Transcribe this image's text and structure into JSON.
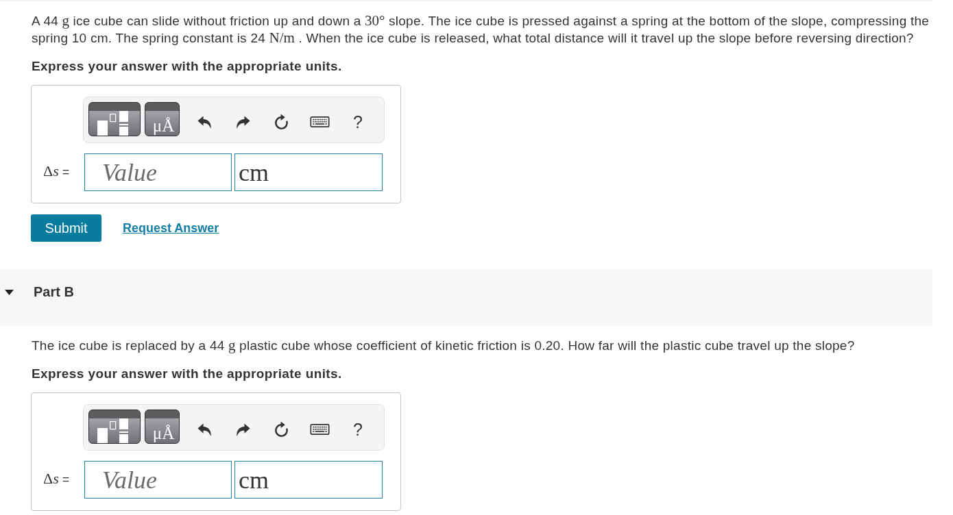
{
  "parts": [
    {
      "question": [
        {
          "kind": "text",
          "text": "A 44 "
        },
        {
          "kind": "math",
          "text": "g"
        },
        {
          "kind": "text",
          "text": " ice cube can slide without friction up and down a "
        },
        {
          "kind": "math",
          "text": "30°"
        },
        {
          "kind": "text",
          "text": " slope. The ice cube is pressed against a spring at the bottom of the slope, compressing the spring 10 cm. The spring constant is 24 "
        },
        {
          "kind": "math",
          "text": "N/m"
        },
        {
          "kind": "text",
          "text": " . When the ice cube is released, what total distance will it travel up the slope before reversing direction?"
        }
      ],
      "instruction": "Express your answer with the appropriate units.",
      "answer": {
        "toolbar": [
          {
            "kind": "templates"
          },
          {
            "kind": "units",
            "label": "μÅ"
          },
          {
            "kind": "undo"
          },
          {
            "kind": "redo"
          },
          {
            "kind": "reset"
          },
          {
            "kind": "keyboard"
          },
          {
            "kind": "help",
            "label": "?"
          }
        ],
        "label": [
          {
            "kind": "math",
            "text": "Δ"
          },
          {
            "kind": "var",
            "text": "s"
          },
          {
            "kind": "text",
            "text": " ="
          }
        ],
        "value": {
          "placeholder": "Value"
        },
        "unit": {
          "value": "cm"
        }
      },
      "actions": [
        {
          "kind": "button",
          "label": "Submit"
        },
        {
          "kind": "link",
          "label": "Request Answer"
        }
      ]
    },
    {
      "header": {
        "label": "Part B",
        "expanded": true
      },
      "question": [
        {
          "kind": "text",
          "text": "The ice cube is replaced by a 44 "
        },
        {
          "kind": "math",
          "text": "g"
        },
        {
          "kind": "text",
          "text": " plastic cube whose coefficient of kinetic friction is 0.20. How far will the plastic cube travel up the slope?"
        }
      ],
      "instruction": "Express your answer with the appropriate units.",
      "answer": {
        "toolbar": [
          {
            "kind": "templates"
          },
          {
            "kind": "units",
            "label": "μÅ"
          },
          {
            "kind": "undo"
          },
          {
            "kind": "redo"
          },
          {
            "kind": "reset"
          },
          {
            "kind": "keyboard"
          },
          {
            "kind": "help",
            "label": "?"
          }
        ],
        "label": [
          {
            "kind": "math",
            "text": "Δ"
          },
          {
            "kind": "var",
            "text": "s"
          },
          {
            "kind": "text",
            "text": " ="
          }
        ],
        "value": {
          "placeholder": "Value"
        },
        "unit": {
          "value": "cm"
        }
      }
    }
  ]
}
